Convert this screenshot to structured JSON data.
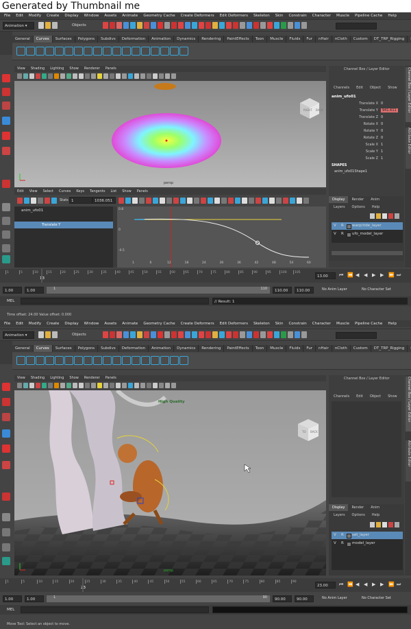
{
  "banner": "Generated by Thumbnail me",
  "menus": [
    "File",
    "Edit",
    "Modify",
    "Create",
    "Display",
    "Window",
    "Assets",
    "Animate",
    "Geometry Cache",
    "Create Deformers",
    "Edit Deformers",
    "Skeleton",
    "Skin",
    "Constrain",
    "Character",
    "Muscle",
    "Pipeline Cache",
    "Help"
  ],
  "mode": "Animation",
  "objects_label": "Objects",
  "shelf_tabs": [
    "General",
    "Curves",
    "Surfaces",
    "Polygons",
    "Subdivs",
    "Deformation",
    "Animation",
    "Dynamics",
    "Rendering",
    "PaintEffects",
    "Toon",
    "Muscle",
    "Fluids",
    "Fur",
    "nHair",
    "nCloth",
    "Custom",
    "DT_TRP_Rigging",
    "Item"
  ],
  "panel_menus": [
    "View",
    "Shading",
    "Lighting",
    "Show",
    "Renderer",
    "Panels"
  ],
  "channel_box_title": "Channel Box / Layer Editor",
  "channel_menus": [
    "Channels",
    "Edit",
    "Object",
    "Show"
  ],
  "side_tabs": {
    "channel": "Channel Box / Layer Editor",
    "attr": "Attribute Editor"
  },
  "layer_tabs": [
    "Display",
    "Render",
    "Anim"
  ],
  "layer_menus": [
    "Layers",
    "Options",
    "Help"
  ],
  "top": {
    "object_name": "anim_ufo01",
    "channels": [
      {
        "label": "Translate X",
        "value": "0"
      },
      {
        "label": "Translate Y",
        "value": "941.611"
      },
      {
        "label": "Translate Z",
        "value": "0"
      },
      {
        "label": "Rotate X",
        "value": "0"
      },
      {
        "label": "Rotate Y",
        "value": "0"
      },
      {
        "label": "Rotate Z",
        "value": "0"
      },
      {
        "label": "Scale X",
        "value": "1"
      },
      {
        "label": "Scale Y",
        "value": "1"
      },
      {
        "label": "Scale Z",
        "value": "1"
      }
    ],
    "shapes_label": "SHAPES",
    "shape_name": "anim_ufo01Shape1",
    "viewport_label": "persp",
    "cube_labels": [
      "RIGHT",
      "BACK"
    ],
    "graph_menus": [
      "Edit",
      "View",
      "Select",
      "Curves",
      "Keys",
      "Tangents",
      "List",
      "Show",
      "Panels"
    ],
    "graph_stats_label": "Stats",
    "graph_stats_fields": [
      "1",
      "1036.051"
    ],
    "outliner_items": [
      "anim_ufo01",
      "Translate Y"
    ],
    "graph_x_ticks": [
      "1",
      "6",
      "12",
      "18",
      "24",
      "30",
      "36",
      "42",
      "48",
      "54",
      "60"
    ],
    "graph_y_ticks": [
      "0.8",
      "0",
      "-0.5"
    ],
    "layers": [
      {
        "v": "V",
        "r": "R",
        "name": "warp/ride_layer"
      },
      {
        "v": "V",
        "r": "R",
        "name": "ufo_model_layer"
      }
    ],
    "timeline_ticks": [
      "1",
      "5",
      "10",
      "15",
      "20",
      "25",
      "30",
      "35",
      "40",
      "45",
      "50",
      "55",
      "60",
      "65",
      "70",
      "75",
      "80",
      "85",
      "90",
      "95",
      "100",
      "105"
    ],
    "current_frame": "13",
    "current_time_field": "13.00",
    "range": {
      "start": "1.00",
      "start2": "1.00",
      "bar_start": "1",
      "bar_end": "110",
      "end": "110.00",
      "end2": "110.00"
    },
    "anim_layer": "No Anim Layer",
    "char_set": "No Character Set",
    "mel_label": "MEL",
    "result": "// Result: 1",
    "time_offset": "Time offset:  24.00    Value offset:   0.000"
  },
  "bottom": {
    "viewport_label": "persp",
    "high_quality": "High Quality",
    "cube_labels": [
      "TO",
      "BACK"
    ],
    "layers": [
      {
        "v": "V",
        "r": "R",
        "name": "set_layer"
      },
      {
        "v": "V",
        "r": "R",
        "name": "model_layer"
      }
    ],
    "timeline_ticks": [
      "1",
      "5",
      "10",
      "15",
      "20",
      "25",
      "30",
      "35",
      "40",
      "45",
      "50",
      "55",
      "60",
      "65",
      "70",
      "75",
      "80",
      "85",
      "90"
    ],
    "current_frame": "23",
    "current_time_field": "23.00",
    "range": {
      "start": "1.00",
      "start2": "1.00",
      "bar_start": "1",
      "bar_end": "90",
      "end": "90.00",
      "end2": "90.00"
    },
    "anim_layer": "No Anim Layer",
    "char_set": "No Character Set",
    "mel_label": "MEL",
    "help_line": "Move Tool: Select an object to move."
  },
  "colors": {
    "accent": "#3aa6d8",
    "selection": "#5a8ab8",
    "curve_highlight": "#e04040",
    "key_yellow": "#e6d23a"
  }
}
